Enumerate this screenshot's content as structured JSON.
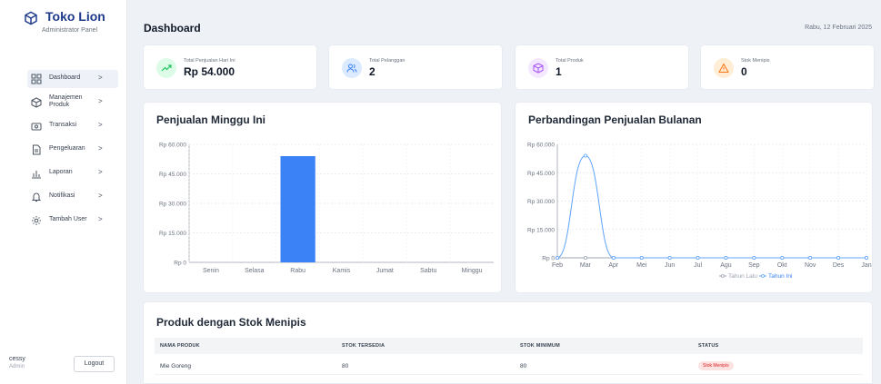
{
  "brand": {
    "title": "Toko Lion",
    "subtitle": "Administrator Panel",
    "color": "#1e3a8a"
  },
  "sidebar": {
    "items": [
      {
        "label": "Dashboard",
        "icon": "dashboard-grid-icon",
        "active": true
      },
      {
        "label": "Manajemen Produk",
        "icon": "box-icon"
      },
      {
        "label": "Transaksi",
        "icon": "transaction-icon"
      },
      {
        "label": "Pengeluaran",
        "icon": "document-icon"
      },
      {
        "label": "Laporan",
        "icon": "bar-chart-icon"
      },
      {
        "label": "Notifikasi",
        "icon": "bell-icon"
      },
      {
        "label": "Tambah User",
        "icon": "gear-icon"
      }
    ],
    "chevron": ">"
  },
  "user": {
    "name": "cessy",
    "role": "Admin",
    "logout_label": "Logout"
  },
  "header": {
    "title": "Dashboard",
    "date": "Rabu, 12 Februari 2025"
  },
  "stats": [
    {
      "label": "Total Penjualan Hari Ini",
      "value": "Rp 54.000",
      "icon": "trend-up-icon",
      "color": "#22c55e"
    },
    {
      "label": "Total Pelanggan",
      "value": "2",
      "icon": "users-icon",
      "color": "#3b82f6"
    },
    {
      "label": "Total Produk",
      "value": "1",
      "icon": "box-icon",
      "color": "#a855f7"
    },
    {
      "label": "Stok Menipis",
      "value": "0",
      "icon": "warning-icon",
      "color": "#f97316"
    }
  ],
  "weekly_chart": {
    "title": "Penjualan Minggu Ini",
    "y_ticks": [
      "Rp 60.000",
      "Rp 45.000",
      "Rp 30.000",
      "Rp 15.000",
      "Rp 0"
    ]
  },
  "monthly_chart": {
    "title": "Perbandingan Penjualan Bulanan",
    "y_ticks": [
      "Rp 60.000",
      "Rp 45.000",
      "Rp 30.000",
      "Rp 15.000",
      "Rp 0"
    ],
    "legend": [
      "Tahun Lalu",
      "Tahun Ini"
    ]
  },
  "chart_data": [
    {
      "type": "bar",
      "title": "Penjualan Minggu Ini",
      "categories": [
        "Senin",
        "Selasa",
        "Rabu",
        "Kamis",
        "Jumat",
        "Sabtu",
        "Minggu"
      ],
      "values": [
        0,
        0,
        54000,
        0,
        0,
        0,
        0
      ],
      "ylim": [
        0,
        60000
      ],
      "grid": true,
      "color": "#3b82f6"
    },
    {
      "type": "line",
      "title": "Perbandingan Penjualan Bulanan",
      "categories": [
        "Feb",
        "Mar",
        "Apr",
        "Mei",
        "Jun",
        "Jul",
        "Agu",
        "Sep",
        "Okt",
        "Nov",
        "Des",
        "Jan"
      ],
      "series": [
        {
          "name": "Tahun Lalu",
          "values": [
            0,
            0,
            0,
            0,
            0,
            0,
            0,
            0,
            0,
            0,
            0,
            0
          ],
          "color": "#9ca3af"
        },
        {
          "name": "Tahun Ini",
          "values": [
            0,
            54000,
            0,
            0,
            0,
            0,
            0,
            0,
            0,
            0,
            0,
            0
          ],
          "color": "#60a5fa"
        }
      ],
      "ylim": [
        0,
        60000
      ],
      "grid": true,
      "legend_position": "bottom"
    }
  ],
  "low_stock": {
    "title": "Produk dengan Stok Menipis",
    "columns": [
      "NAMA PRODUK",
      "STOK TERSEDIA",
      "STOK MINIMUM",
      "STATUS"
    ],
    "rows": [
      {
        "name": "Mie Goreng",
        "stock": "80",
        "minimum": "80",
        "status": "Stok Menipis"
      }
    ]
  }
}
